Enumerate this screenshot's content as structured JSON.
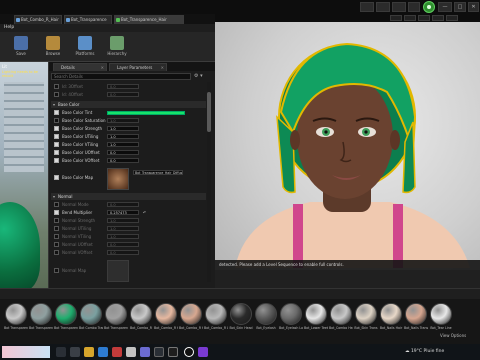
{
  "app": {
    "tabs": [
      "Bot_Combo_R_Hair",
      "Bot_Transparence",
      "Bot_Transparence_Hair"
    ],
    "menu_help": "Help"
  },
  "toolbar": {
    "items": [
      {
        "label": "Save",
        "icon": "save-icon",
        "color": "#4b6fa8"
      },
      {
        "label": "Browse",
        "icon": "folder-icon",
        "color": "#b58a3c"
      },
      {
        "label": "Platforms",
        "icon": "platforms-icon",
        "color": "#5b8fc8"
      },
      {
        "label": "Hierarchy",
        "icon": "hierarchy-icon",
        "color": "#6b9d6b"
      }
    ]
  },
  "preview": {
    "label": "Lit",
    "note": "Lighting needs to be rebuilt"
  },
  "details": {
    "tabs": [
      "Details",
      "Layer Parameters"
    ],
    "search_placeholder": "Search Details",
    "rows_top": [
      {
        "name": "Id: 3Offset",
        "value": "0.0",
        "enabled": false
      },
      {
        "name": "Id: 4Offset",
        "value": "0.0",
        "enabled": false
      }
    ],
    "section_basecolor": "Base Color",
    "basecolor_tint": "Base Color Tint",
    "basecolor_rows": [
      {
        "name": "Base Color Saturation",
        "value": "1.0",
        "checked": false
      },
      {
        "name": "Base Color Strength",
        "value": "1.0",
        "checked": true
      },
      {
        "name": "Base Color UTiling",
        "value": "1.0",
        "checked": true
      },
      {
        "name": "Base Color VTiling",
        "value": "1.0",
        "checked": true
      },
      {
        "name": "Base Color UOffset",
        "value": "0.0",
        "checked": true
      },
      {
        "name": "Base Color VOffset",
        "value": "0.0",
        "checked": true
      }
    ],
    "basecolor_map_label": "Base Color Map",
    "basecolor_map_file": "Bot_Transparence_Hair_Diffuse",
    "section_normal": "Normal",
    "normal_rows": [
      {
        "name": "Normal Mode",
        "value": "0.0",
        "checked": false
      },
      {
        "name": "Bend Multiplier",
        "value": "0.257473",
        "checked": true
      },
      {
        "name": "Normal Strength",
        "value": "1.0",
        "checked": false
      },
      {
        "name": "Normal UTiling",
        "value": "1.0",
        "checked": false
      },
      {
        "name": "Normal VTiling",
        "value": "1.0",
        "checked": false
      },
      {
        "name": "Normal UOffset",
        "value": "0.0",
        "checked": false
      },
      {
        "name": "Normal VOffset",
        "value": "0.0",
        "checked": false
      }
    ],
    "normal_map_label": "Normal Map"
  },
  "viewport": {
    "message": "detected. Please add a Level Sequence to enable full controls."
  },
  "content_browser": {
    "items": [
      {
        "label": "Bot Transparence",
        "color": "#c9c9c9"
      },
      {
        "label": "Bot Transparence",
        "color": "#8fa0a0"
      },
      {
        "label": "Bot Transparence",
        "color": "#1fae6e"
      },
      {
        "label": "Bot Combo Transparence",
        "color": "#7aa0a0"
      },
      {
        "label": "Bot Transparence",
        "color": "#a0a0a0"
      },
      {
        "label": "Bot_Combo_R",
        "color": "#c9c9c9"
      },
      {
        "label": "Bot_Combo_R Hair",
        "color": "#e6b8a0"
      },
      {
        "label": "Bot_Combo_R Hair Alt",
        "color": "#d8a890"
      },
      {
        "label": "Bot_Combo_R Lens",
        "color": "#b8b8b8"
      },
      {
        "label": "Bot_Skin Head",
        "color": "#2a2a2a"
      },
      {
        "label": "Bot_Eyelash",
        "color": "#5a5a5a"
      },
      {
        "label": "Bot_Eyelash Lower",
        "color": "#6b6b6b"
      },
      {
        "label": "Bot_Lower Teeth",
        "color": "#e6e6e6"
      },
      {
        "label": "Bot_Combo Head",
        "color": "#c8c8c8"
      },
      {
        "label": "Bot_Skin Trans",
        "color": "#ddd2c4"
      },
      {
        "label": "Bot_Nails Hair",
        "color": "#e8d8c8"
      },
      {
        "label": "Bot_Nails Trans",
        "color": "#d6a690"
      },
      {
        "label": "Bot_Tear Line",
        "color": "#e8e8e8"
      }
    ],
    "view_options": "View Options"
  },
  "taskbar": {
    "weather": "19°C",
    "weather_desc": "Pluie fine"
  }
}
